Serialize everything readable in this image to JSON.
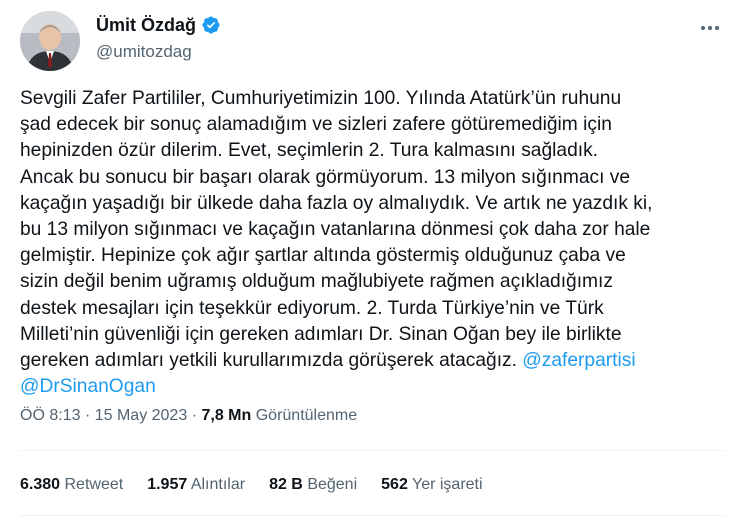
{
  "author": {
    "display_name": "Ümit Özdağ",
    "handle": "@umitozdag",
    "verified": true
  },
  "tweet": {
    "text_plain": "Sevgili Zafer Partililer, Cumhuriyetimizin 100. Yılında Atatürk’ün ruhunu\nşad edecek bir sonuç alamadığım ve sizleri zafere götüremediğim için\nhepinizden özür dilerim. Evet, seçimlerin 2. Tura kalmasını sağladık.\nAncak bu sonucu bir başarı olarak görmüyorum. 13 milyon sığınmacı ve\nkaçağın yaşadığı bir ülkede daha fazla oy almalıydık. Ve artık ne yazdık ki,\nbu 13 milyon sığınmacı ve kaçağın vatanlarına dönmesi çok daha zor hale\ngelmiştir. Hepinize çok ağır şartlar altında göstermiş olduğunuz çaba ve\nsizin değil benim uğramış olduğum mağlubiyete rağmen açıkladığımız\ndestek mesajları için teşekkür ediyorum. 2. Turda Türkiye’nin ve Türk\nMilleti’nin güvenliği için gereken adımları Dr. Sinan Oğan bey ile birlikte\ngereken adımları yetkili kurullarımızda görüşerek atacağız. ",
    "mention_1": "@zaferpartisi",
    "mention_2": "@DrSinanOgan"
  },
  "meta": {
    "time": "ÖÖ 8:13",
    "separator": "·",
    "date": "15 May 2023",
    "views_count": "7,8 Mn",
    "views_label": "Görüntülenme"
  },
  "stats": [
    {
      "count": "6.380",
      "label": "Retweet"
    },
    {
      "count": "1.957",
      "label": "Alıntılar"
    },
    {
      "count": "82 B",
      "label": "Beğeni"
    },
    {
      "count": "562",
      "label": "Yer işareti"
    }
  ],
  "icons": {
    "verified": "verified-badge-icon",
    "more": "more-options-icon"
  },
  "colors": {
    "text": "#0f1419",
    "secondary": "#536471",
    "accent": "#1d9bf0",
    "divider": "#eff3f4"
  }
}
